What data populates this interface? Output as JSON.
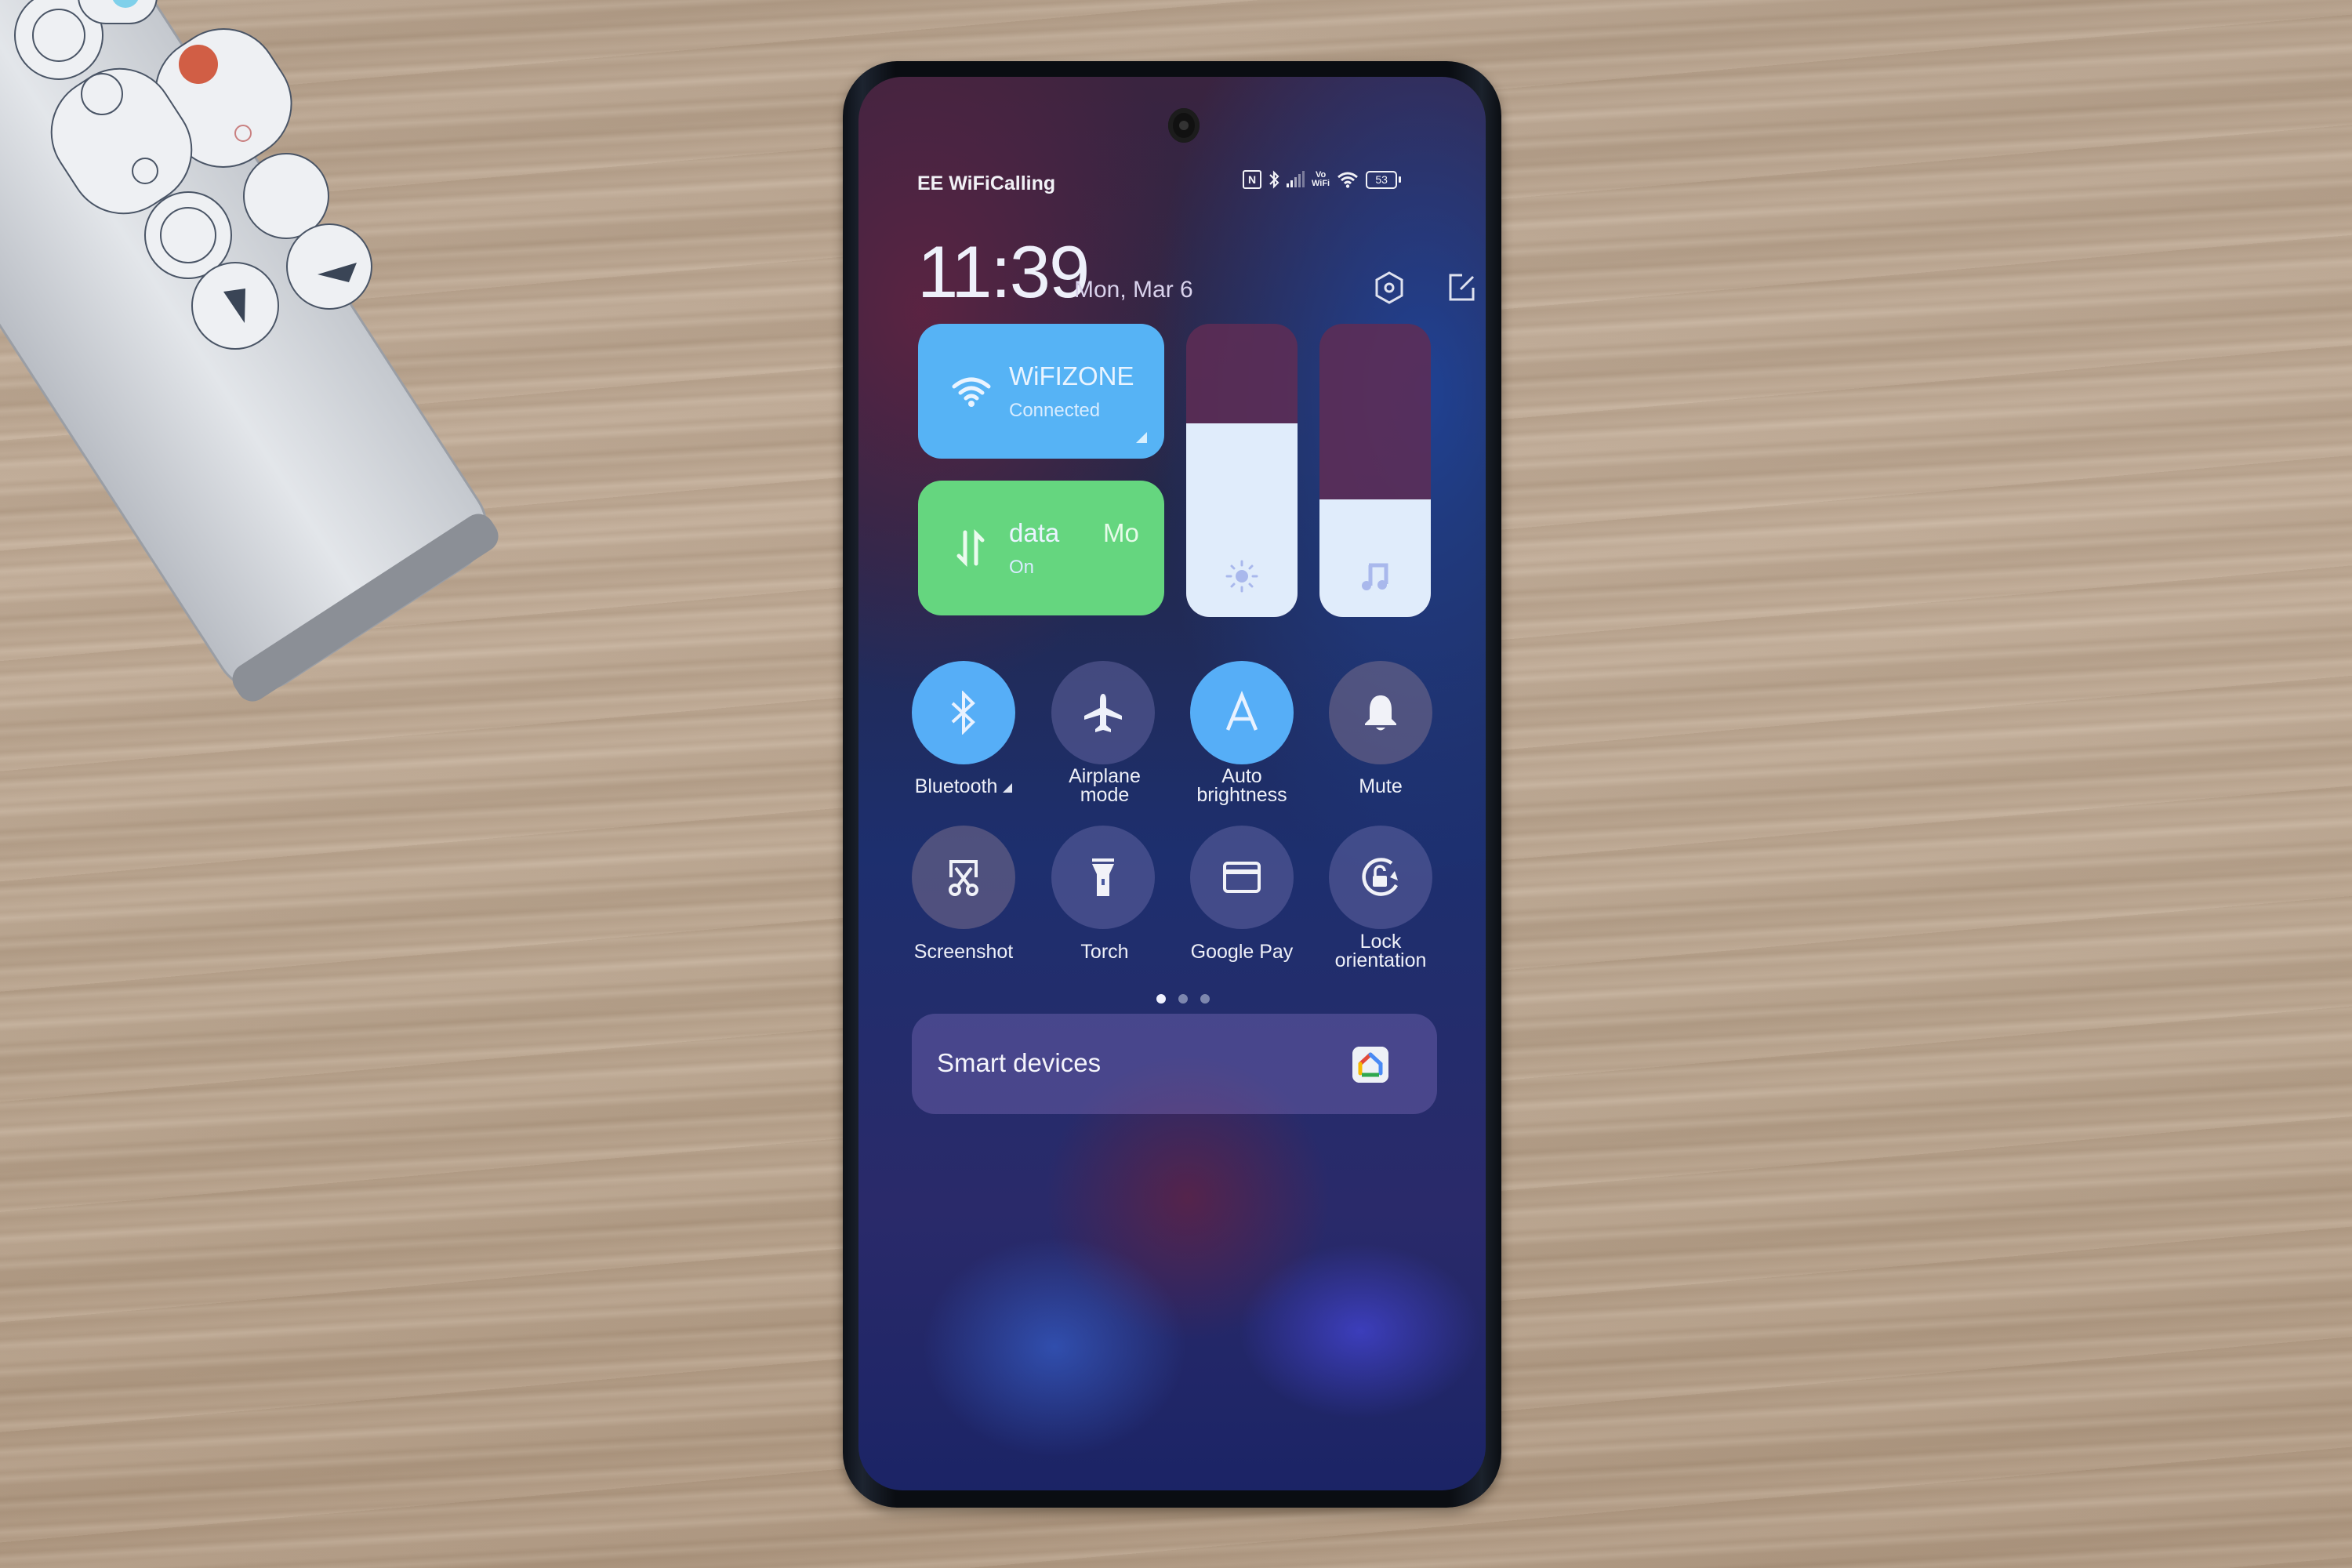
{
  "status_bar": {
    "carrier": "EE WiFiCalling",
    "icons": [
      "nfc-icon",
      "bluetooth-icon",
      "signal-icon",
      "vowifi-icon",
      "wifi-icon",
      "battery-icon"
    ],
    "vowifi_top": "Vo",
    "vowifi_bottom": "WiFi",
    "nfc_glyph": "N",
    "battery_level": "53"
  },
  "header": {
    "time": "11:39",
    "date": "Mon, Mar 6",
    "settings_icon": "settings-hexagon-icon",
    "edit_icon": "edit-icon"
  },
  "tiles": {
    "wifi": {
      "name": "WiFIZONE",
      "status": "Connected",
      "color": "#56b3f5"
    },
    "mobile_data": {
      "name": "data",
      "name_continued": "Mo",
      "status": "On",
      "color": "#65d67f"
    }
  },
  "sliders": {
    "brightness": {
      "label": "Brightness",
      "level": 0.66
    },
    "volume": {
      "label": "Media volume",
      "level": 0.4
    }
  },
  "toggles": [
    {
      "id": "bluetooth",
      "label": "Bluetooth",
      "has_arrow": true,
      "state": "on",
      "icon": "bluetooth-icon"
    },
    {
      "id": "airplane",
      "label": "Airplane mode",
      "state": "off",
      "icon": "airplane-icon"
    },
    {
      "id": "auto-brightness",
      "label": "Auto brightness",
      "state": "on",
      "icon": "auto-brightness-icon",
      "glyph": "A"
    },
    {
      "id": "mute",
      "label": "Mute",
      "state": "off",
      "icon": "bell-icon"
    },
    {
      "id": "screenshot",
      "label": "Screenshot",
      "state": "off",
      "icon": "screenshot-scissors-icon"
    },
    {
      "id": "torch",
      "label": "Torch",
      "state": "off",
      "icon": "torch-icon"
    },
    {
      "id": "google-pay",
      "label": "Google Pay",
      "state": "off",
      "icon": "card-icon"
    },
    {
      "id": "lock-orientation",
      "label": "Lock orientation",
      "state": "off",
      "icon": "rotation-lock-icon"
    }
  ],
  "labels": {
    "bluetooth": "Bluetooth",
    "airplane_1": "Airplane",
    "airplane_2": "mode",
    "auto_1": "Auto",
    "auto_2": "brightness",
    "mute": "Mute",
    "screenshot": "Screenshot",
    "torch": "Torch",
    "gpay": "Google Pay",
    "lock_1": "Lock",
    "lock_2": "orientation"
  },
  "pager": {
    "pages": 3,
    "current": 1
  },
  "smart_devices": {
    "label": "Smart devices",
    "icon": "google-home-icon"
  },
  "colors": {
    "accent_blue": "#56aef7",
    "wifi_tile": "#56b3f5",
    "data_tile": "#65d67f",
    "slider_track": "#5f2d55",
    "slider_fill": "#e0ecfb"
  }
}
